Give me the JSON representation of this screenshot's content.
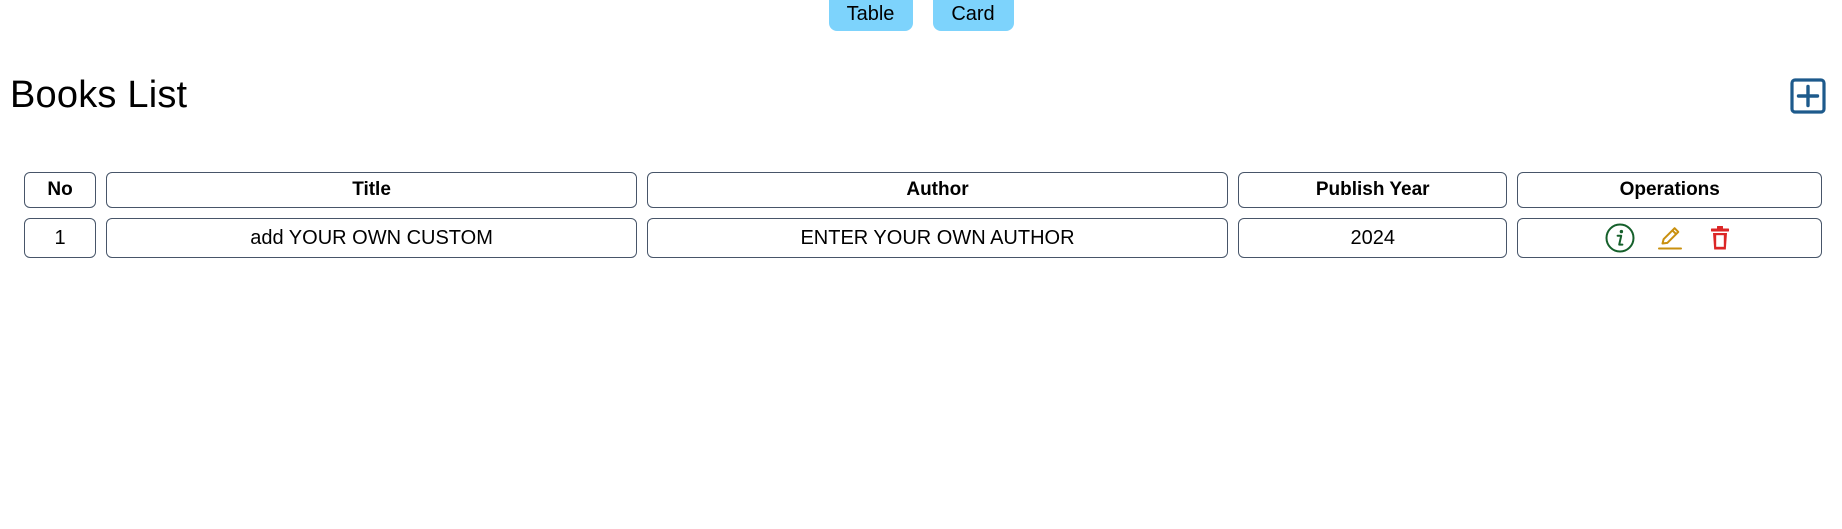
{
  "view_toggle": {
    "table_label": "Table",
    "card_label": "Card"
  },
  "page": {
    "title": "Books List"
  },
  "add_button": {
    "icon": "plus-square-icon",
    "color": "#1d5a8c"
  },
  "table": {
    "headers": {
      "no": "No",
      "title": "Title",
      "author": "Author",
      "publish_year": "Publish Year",
      "operations": "Operations"
    },
    "rows": [
      {
        "no": "1",
        "title": "add YOUR OWN CUSTOM",
        "author": "ENTER YOUR OWN AUTHOR",
        "publish_year": "2024",
        "operations": [
          {
            "icon": "info-circle-icon",
            "color": "#15602b"
          },
          {
            "icon": "pencil-edit-icon",
            "color": "#c9900f"
          },
          {
            "icon": "trash-delete-icon",
            "color": "#dc2626"
          }
        ]
      }
    ]
  },
  "colors": {
    "toggle_background": "#7dd3fc",
    "cell_border": "#475569"
  }
}
